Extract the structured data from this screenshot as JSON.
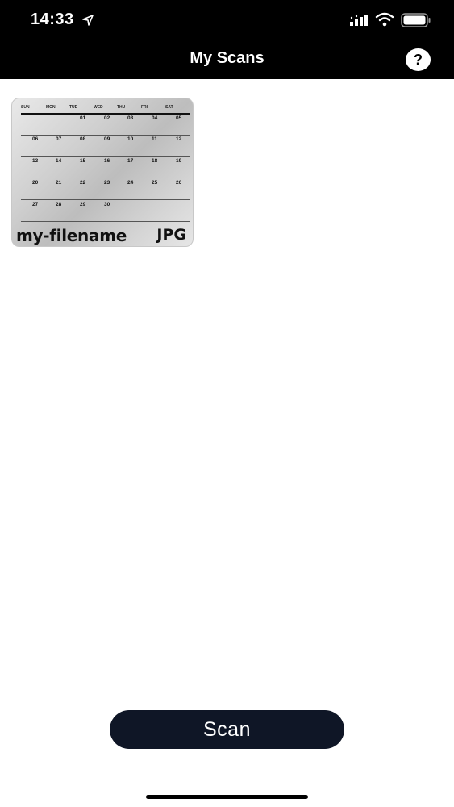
{
  "status_bar": {
    "time": "14:33",
    "icons": [
      "location-icon",
      "signal-icon",
      "wifi-icon",
      "battery-icon"
    ]
  },
  "nav": {
    "title": "My Scans",
    "help_label": "?"
  },
  "scans": [
    {
      "file_name": "my-filename",
      "file_type": "JPG",
      "calendar": {
        "weekdays": [
          "SUN",
          "MON",
          "TUE",
          "WED",
          "THU",
          "FRI",
          "SAT"
        ],
        "weeks": [
          [
            "",
            "",
            "",
            "01",
            "02",
            "03",
            "04",
            "05"
          ],
          [
            "06",
            "07",
            "08",
            "09",
            "10",
            "11",
            "12"
          ],
          [
            "13",
            "14",
            "15",
            "16",
            "17",
            "18",
            "19"
          ],
          [
            "20",
            "21",
            "22",
            "23",
            "24",
            "25",
            "26"
          ],
          [
            "27",
            "28",
            "29",
            "30",
            "",
            "",
            ""
          ]
        ]
      }
    }
  ],
  "actions": {
    "scan_label": "Scan"
  },
  "colors": {
    "topbar": "#000000",
    "scan_button": "#0f1626",
    "background": "#ffffff"
  }
}
